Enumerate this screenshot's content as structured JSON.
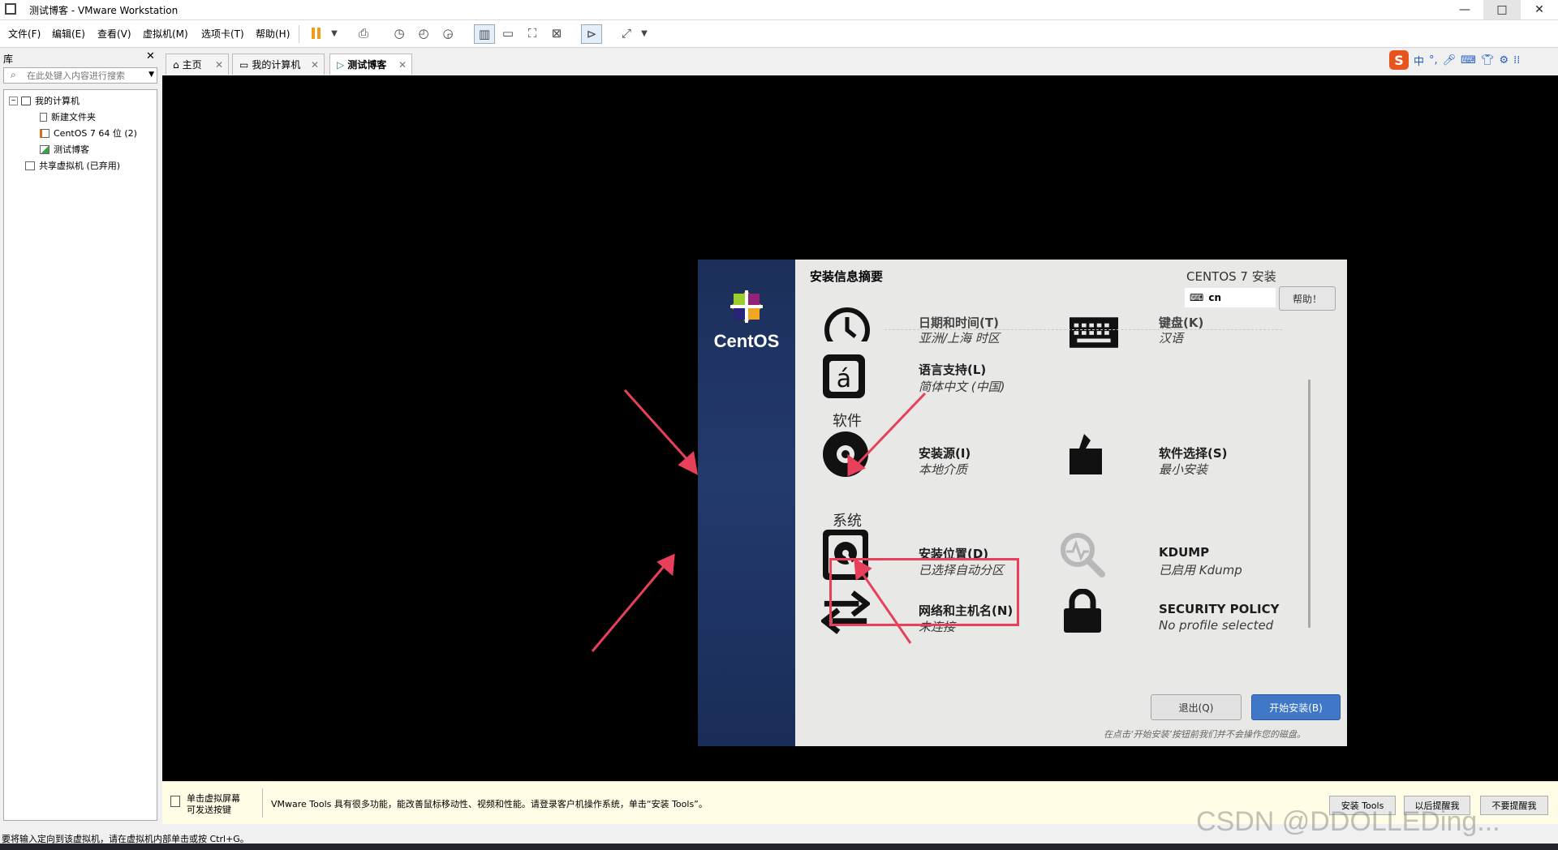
{
  "window": {
    "title": "测试博客 - VMware Workstation",
    "minimize": "—",
    "maximize": "□",
    "close": "✕"
  },
  "menu": [
    "文件(F)",
    "编辑(E)",
    "查看(V)",
    "虚拟机(M)",
    "选项卡(T)",
    "帮助(H)"
  ],
  "library": {
    "header": "库",
    "close": "✕",
    "search_placeholder": "在此处键入内容进行搜索",
    "tree": {
      "my_computer": "我的计算机",
      "new_folder": "新建文件夹",
      "centos": "CentOS 7 64 位 (2)",
      "test_blog": "测试博客",
      "shared": "共享虚拟机 (已弃用)"
    }
  },
  "tabs": [
    {
      "label": "主页"
    },
    {
      "label": "我的计算机"
    },
    {
      "label": "测试博客"
    }
  ],
  "ime": {
    "label": "中",
    "punct": "°,"
  },
  "installer": {
    "brand": "CentOS",
    "header_title": "安装信息摘要",
    "product": "CENTOS 7 安装",
    "keyboard_layout": "cn",
    "help_button": "帮助！",
    "datetime_title": "日期和时间(T)",
    "datetime_status": "亚洲/上海 时区",
    "keyboard_title": "键盘(K)",
    "keyboard_status": "汉语",
    "lang_title": "语言支持(L)",
    "lang_status": "简体中文 (中国)",
    "software_section": "软件",
    "source_title": "安装源(I)",
    "source_status": "本地介质",
    "swsel_title": "软件选择(S)",
    "swsel_status": "最小安装",
    "system_section": "系统",
    "dest_title": "安装位置(D)",
    "dest_status": "已选择自动分区",
    "kdump_title": "KDUMP",
    "kdump_status": "已启用 Kdump",
    "network_title": "网络和主机名(N)",
    "network_status": "未连接",
    "security_title": "SECURITY POLICY",
    "security_status": "No profile selected",
    "quit_button": "退出(Q)",
    "begin_button": "开始安装(B)",
    "footer_note": "在点击‘开始安装’按钮前我们并不会操作您的磁盘。"
  },
  "hint": {
    "click_line1": "单击虚拟屏幕",
    "click_line2": "可发送按键",
    "message": "VMware Tools 具有很多功能，能改善鼠标移动性、视频和性能。请登录客户机操作系统，单击“安装 Tools”。",
    "install_tools": "安装 Tools",
    "remind_later": "以后提醒我",
    "never_remind": "不要提醒我"
  },
  "status_text": "要将输入定向到该虚拟机，请在虚拟机内部单击或按 Ctrl+G。",
  "watermark": "CSDN @DDOLLEDing...",
  "colors": {
    "highlight": "#e8405a",
    "begin_button": "#3e78c7",
    "sidebar": "#1f3463"
  }
}
